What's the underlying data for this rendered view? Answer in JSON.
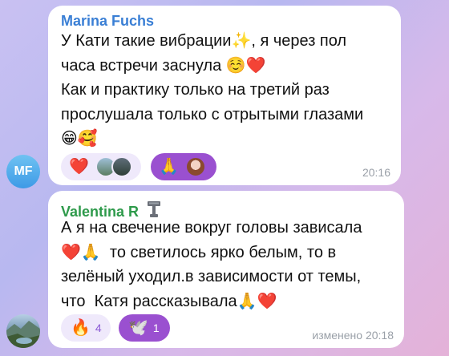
{
  "messages": [
    {
      "sender": "Marina Fuchs",
      "sender_color": "#3a7fd5",
      "avatar_initials": "MF",
      "lines": [
        "У Кати такие вибрации✨, я через пол",
        "часа встречи заснула ☺️❤️",
        "Как и практику только на третий раз",
        "прослушала только с отрытыми глазами",
        "😁🥰"
      ],
      "reactions": [
        {
          "emoji": "❤️",
          "icon": "heart-icon",
          "users": [
            "landscape-avatar",
            "couple-avatar"
          ]
        },
        {
          "emoji": "🙏",
          "icon": "folded-hands-icon",
          "users": [
            "woman-avatar"
          ]
        }
      ],
      "time": "20:16"
    },
    {
      "sender": "Valentina R",
      "sender_color": "#2e9a4b",
      "sender_badge_icon": "hammer-pendant-icon",
      "lines": [
        "А я на свечение вокруг головы зависала",
        "❤️🙏  то светилось ярко белым, то в",
        "зелёный уходил.в зависимости от темы,",
        "что  Катя рассказывала🙏❤️"
      ],
      "reactions": [
        {
          "emoji": "🔥",
          "icon": "fire-icon",
          "count": "4"
        },
        {
          "emoji": "🕊️",
          "icon": "dove-icon",
          "count": "1"
        }
      ],
      "edited_label": "изменено",
      "time": "20:18"
    }
  ]
}
